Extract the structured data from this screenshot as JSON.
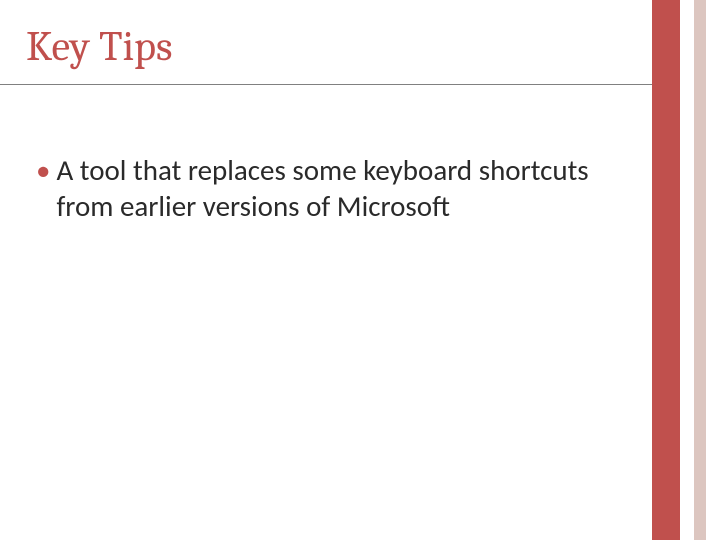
{
  "slide": {
    "title": "Key Tips",
    "bullets": [
      {
        "text": "A tool that replaces some keyboard shortcuts from earlier versions of Microsoft"
      }
    ]
  },
  "colors": {
    "accent": "#c0504d",
    "accent_light": "#dcc6c0",
    "text": "#2a2a2a"
  }
}
